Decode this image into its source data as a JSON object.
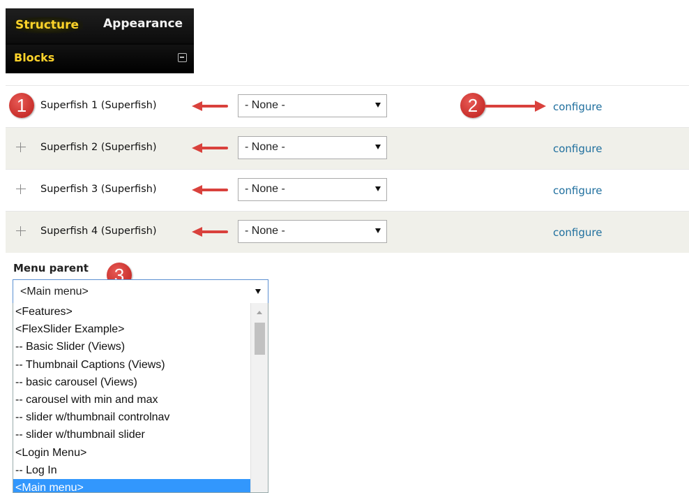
{
  "toolbar": {
    "tabs": [
      "Structure",
      "Appearance"
    ],
    "subtab": "Blocks",
    "exit_icon": "exit-icon"
  },
  "blocks": {
    "rows": [
      {
        "name": "Superfish 1 (Superfish)",
        "region": "- None -",
        "action": "configure"
      },
      {
        "name": "Superfish 2 (Superfish)",
        "region": "- None -",
        "action": "configure"
      },
      {
        "name": "Superfish 3 (Superfish)",
        "region": "- None -",
        "action": "configure"
      },
      {
        "name": "Superfish 4 (Superfish)",
        "region": "- None -",
        "action": "configure"
      }
    ]
  },
  "badges": [
    "1",
    "2",
    "3"
  ],
  "menu_parent": {
    "label": "Menu parent",
    "selected": "<Main menu>",
    "options": [
      "<Features>",
      "<FlexSlider Example>",
      "-- Basic Slider (Views)",
      "-- Thumbnail Captions (Views)",
      "-- basic carousel (Views)",
      "-- carousel with min and max",
      "-- slider w/thumbnail controlnav",
      "-- slider w/thumbnail slider",
      "<Login Menu>",
      "-- Log In",
      "<Main menu>"
    ],
    "highlighted_index": 10
  },
  "colors": {
    "toolbar_active": "#ffd42a",
    "link": "#1f6f9e",
    "badge": "#d9413c",
    "selection": "#3297fd",
    "arrow": "#d9413c"
  }
}
